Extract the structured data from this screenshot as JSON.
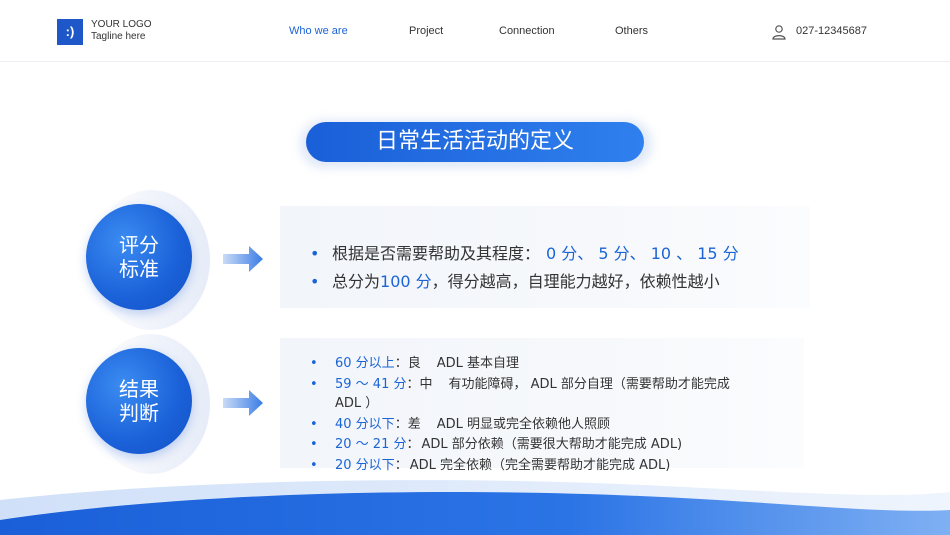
{
  "header": {
    "logo_mark": ":)",
    "logo_line1": "YOUR LOGO",
    "logo_line2": "Tagline here",
    "nav": [
      "Who we are",
      "Project",
      "Connection",
      "Others"
    ],
    "phone": "027-12345687"
  },
  "title": "日常生活活动的定义",
  "section1": {
    "circle_line1": "评分",
    "circle_line2": "标准",
    "bullets": [
      {
        "text": "根据是否需要帮助及其程度：",
        "highlight": "0 分、 5 分、 10 、 15 分",
        "tail": ""
      },
      {
        "text": "总分为",
        "highlight": "100 分",
        "tail": "，得分越高，自理能力越好，依赖性越小"
      }
    ]
  },
  "section2": {
    "circle_line1": "结果",
    "circle_line2": "判断",
    "items": [
      {
        "label": "60 分以上",
        "sep": "：",
        "grade": "良",
        "desc": "ADL 基本自理"
      },
      {
        "label": "59 ～ 41 分",
        "sep": "：",
        "grade": "中",
        "desc": "有功能障碍， ADL 部分自理（需要帮助才能完成",
        "desc2": "ADL ）"
      },
      {
        "label": "40 分以下",
        "sep": "：",
        "grade": "差",
        "desc": "ADL 明显或完全依赖他人照顾"
      },
      {
        "label": "20 ～ 21 分",
        "sep": "：",
        "grade": "",
        "desc": "ADL 部分依赖（需要很大帮助才能完成 ADL)"
      },
      {
        "label": "20 分以下",
        "sep": "：",
        "grade": "",
        "desc": "ADL 完全依赖（完全需要帮助才能完成 ADL)"
      }
    ]
  },
  "colors": {
    "accent": "#1b64d6",
    "accent_light": "#2f80ee",
    "box_bg": "#f2f5fa"
  }
}
